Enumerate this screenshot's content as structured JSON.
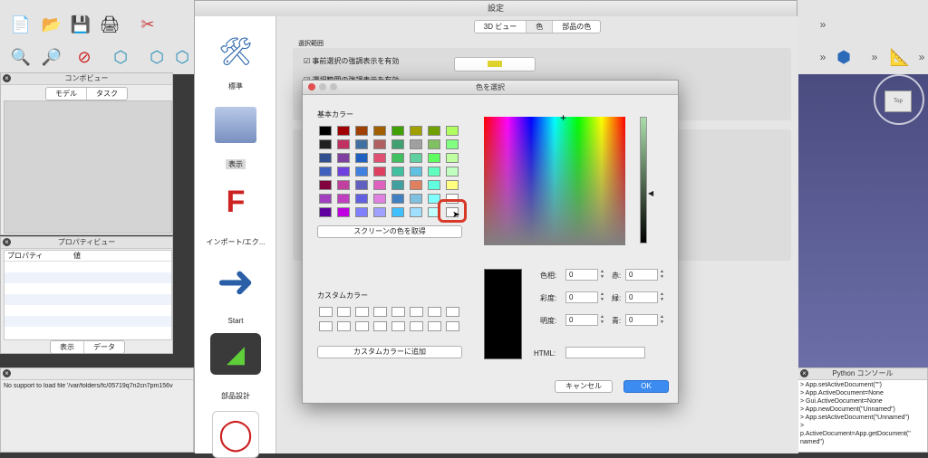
{
  "main": {
    "combo_title": "コンボビュー",
    "combo_tabs": [
      "モデル",
      "タスク"
    ],
    "props_title": "プロパティビュー",
    "props_headers": [
      "プロパティ",
      "値"
    ],
    "bottom_tabs": [
      "表示",
      "データ"
    ],
    "report_text": "No support to load file '/var/folders/fc/05719q7n2cn7pm156v",
    "cube_label": "Top",
    "python_title": "Python コンソール",
    "python_lines": [
      "> App.setActiveDocument(\"\")",
      "> App.ActiveDocument=None",
      "> Gui.ActiveDocument=None",
      "> App.newDocument(\"Unnamed\")",
      "> App.setActiveDocument(\"Unnamed\")",
      ">",
      "p.ActiveDocument=App.getDocument(\"",
      "named\")"
    ]
  },
  "prefs": {
    "title": "設定",
    "tabs": [
      "3D ビュー",
      "色",
      "部品の色"
    ],
    "section": "選択範囲",
    "check1": "事前選択の強調表示を有効",
    "check2": "選択範囲の強調表示を有効",
    "sidebar": [
      "標準",
      "表示",
      "インポート/エク...",
      "Start",
      "部品設計"
    ]
  },
  "picker": {
    "title": "色を選択",
    "basic_label": "基本カラー",
    "screen_button": "スクリーンの色を取得",
    "custom_label": "カスタムカラー",
    "add_custom_button": "カスタムカラーに追加",
    "fields": {
      "hue_label": "色相:",
      "hue": "0",
      "sat_label": "彩度:",
      "sat": "0",
      "val_label": "明度:",
      "val": "0",
      "red_label": "赤:",
      "red": "0",
      "green_label": "緑:",
      "green": "0",
      "blue_label": "青:",
      "blue": "0"
    },
    "html_label": "HTML:",
    "html_value": "",
    "cancel": "キャンセル",
    "ok": "OK",
    "basic_colors": [
      [
        "#000000",
        "#a00000",
        "#a04000",
        "#a06000",
        "#40a000",
        "#a0a000",
        "#70a000",
        "#b0ff60"
      ],
      [
        "#202020",
        "#c03060",
        "#4070a0",
        "#b06060",
        "#40a070",
        "#a0a0a0",
        "#80c060",
        "#80ff80"
      ],
      [
        "#305090",
        "#8040a0",
        "#2060c0",
        "#e05070",
        "#40c060",
        "#60d0a0",
        "#60ff60",
        "#c0ffa0"
      ],
      [
        "#4060c0",
        "#7040e0",
        "#4080e0",
        "#e04060",
        "#40c0a0",
        "#60c0e0",
        "#60ffc0",
        "#c0ffc0"
      ],
      [
        "#800040",
        "#c040a0",
        "#6060c0",
        "#e060c0",
        "#40a0a0",
        "#e08060",
        "#60ffe0",
        "#ffff80"
      ],
      [
        "#a040c0",
        "#c040c0",
        "#6060e0",
        "#e080e0",
        "#4080c0",
        "#80c0e0",
        "#80ffff",
        "#ffffff"
      ],
      [
        "#6000a0",
        "#c000e0",
        "#8080ff",
        "#a0a0ff",
        "#40c0ff",
        "#a0e0ff",
        "#c0ffff",
        "#ffffff"
      ]
    ],
    "accent": "#d83a2a"
  }
}
